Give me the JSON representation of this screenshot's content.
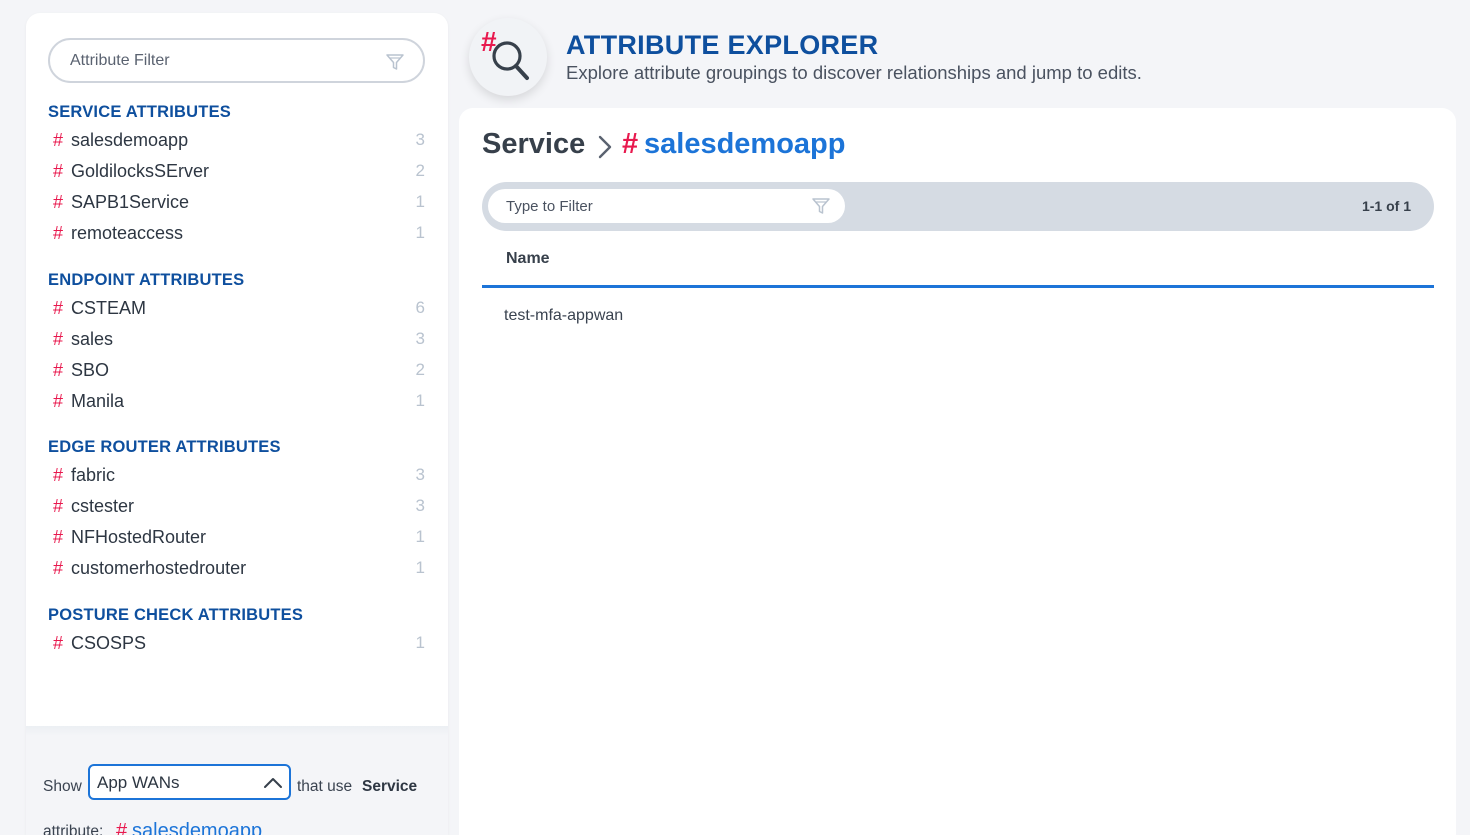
{
  "sidebar": {
    "filter_placeholder": "Attribute Filter",
    "groups": [
      {
        "title": "SERVICE ATTRIBUTES",
        "items": [
          {
            "hash": "#",
            "name": "salesdemoapp",
            "count": "3"
          },
          {
            "hash": "#",
            "name": "GoldilocksSErver",
            "count": "2"
          },
          {
            "hash": "#",
            "name": "SAPB1Service",
            "count": "1"
          },
          {
            "hash": "#",
            "name": "remoteaccess",
            "count": "1"
          }
        ]
      },
      {
        "title": "ENDPOINT ATTRIBUTES",
        "items": [
          {
            "hash": "#",
            "name": "CSTEAM",
            "count": "6"
          },
          {
            "hash": "#",
            "name": "sales",
            "count": "3"
          },
          {
            "hash": "#",
            "name": "SBO",
            "count": "2"
          },
          {
            "hash": "#",
            "name": "Manila",
            "count": "1"
          }
        ]
      },
      {
        "title": "EDGE ROUTER ATTRIBUTES",
        "items": [
          {
            "hash": "#",
            "name": "fabric",
            "count": "3"
          },
          {
            "hash": "#",
            "name": "cstester",
            "count": "3"
          },
          {
            "hash": "#",
            "name": "NFHostedRouter",
            "count": "1"
          },
          {
            "hash": "#",
            "name": "customerhostedrouter",
            "count": "1"
          }
        ]
      },
      {
        "title": "POSTURE CHECK ATTRIBUTES",
        "items": [
          {
            "hash": "#",
            "name": "CSOSPS",
            "count": "1"
          }
        ]
      }
    ],
    "footer": {
      "show_label": "Show",
      "selected": "App WANs",
      "that_use_label": "that use",
      "attr_type": "Service",
      "attribute_label": "attribute:",
      "hash": "#",
      "attribute": "salesdemoapp"
    }
  },
  "header": {
    "logo_hash": "#",
    "title": "ATTRIBUTE EXPLORER",
    "subtitle": "Explore attribute groupings to discover relationships and jump to edits."
  },
  "main": {
    "breadcrumb_root": "Service",
    "breadcrumb_hash": "#",
    "breadcrumb_attr": "salesdemoapp",
    "filter_placeholder": "Type to Filter",
    "pager": "1-1 of 1",
    "column_name": "Name",
    "rows": [
      {
        "name": "test-mfa-appwan"
      }
    ]
  },
  "colors": {
    "accent_blue": "#1c74d8",
    "title_blue": "#0e4f9e",
    "hash_red": "#e8194e",
    "count_gray": "#b9c3cf"
  }
}
